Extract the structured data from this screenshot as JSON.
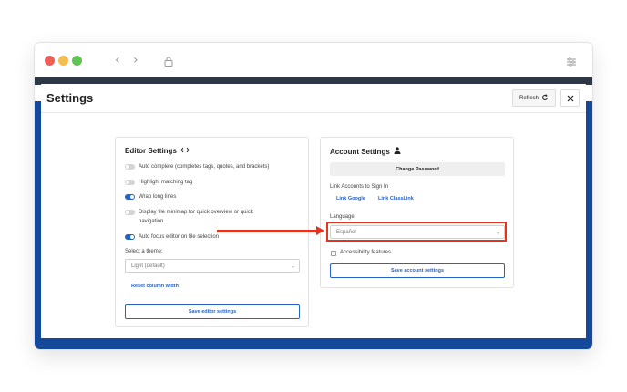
{
  "modal": {
    "title": "Settings",
    "refresh_label": "Refresh"
  },
  "editor": {
    "title": "Editor Settings",
    "options": [
      {
        "label": "Auto complete (completes tags, quotes, and brackets)",
        "on": false
      },
      {
        "label": "Highlight matching tag",
        "on": false
      },
      {
        "label": "Wrap long lines",
        "on": true
      },
      {
        "label": "Display file minimap for quick overview or quick",
        "label2": "navigation",
        "on": false
      },
      {
        "label": "Auto focus editor on file selection",
        "on": true
      }
    ],
    "theme_label": "Select a theme:",
    "theme_value": "Light (default)",
    "reset_label": "Reset column width",
    "save_label": "Save editor settings"
  },
  "account": {
    "title": "Account Settings",
    "change_password_label": "Change Password",
    "link_accounts_label": "Link Accounts to Sign In",
    "link_google": "Link Google",
    "link_classlink": "Link ClassLink",
    "language_label": "Language",
    "language_value": "Español",
    "accessibility_label": "Accessibility features",
    "save_label": "Save account settings"
  },
  "annotation": {
    "color": "#e5331e"
  },
  "colors": {
    "accent": "#2563c9",
    "background_blue": "#13489a"
  }
}
